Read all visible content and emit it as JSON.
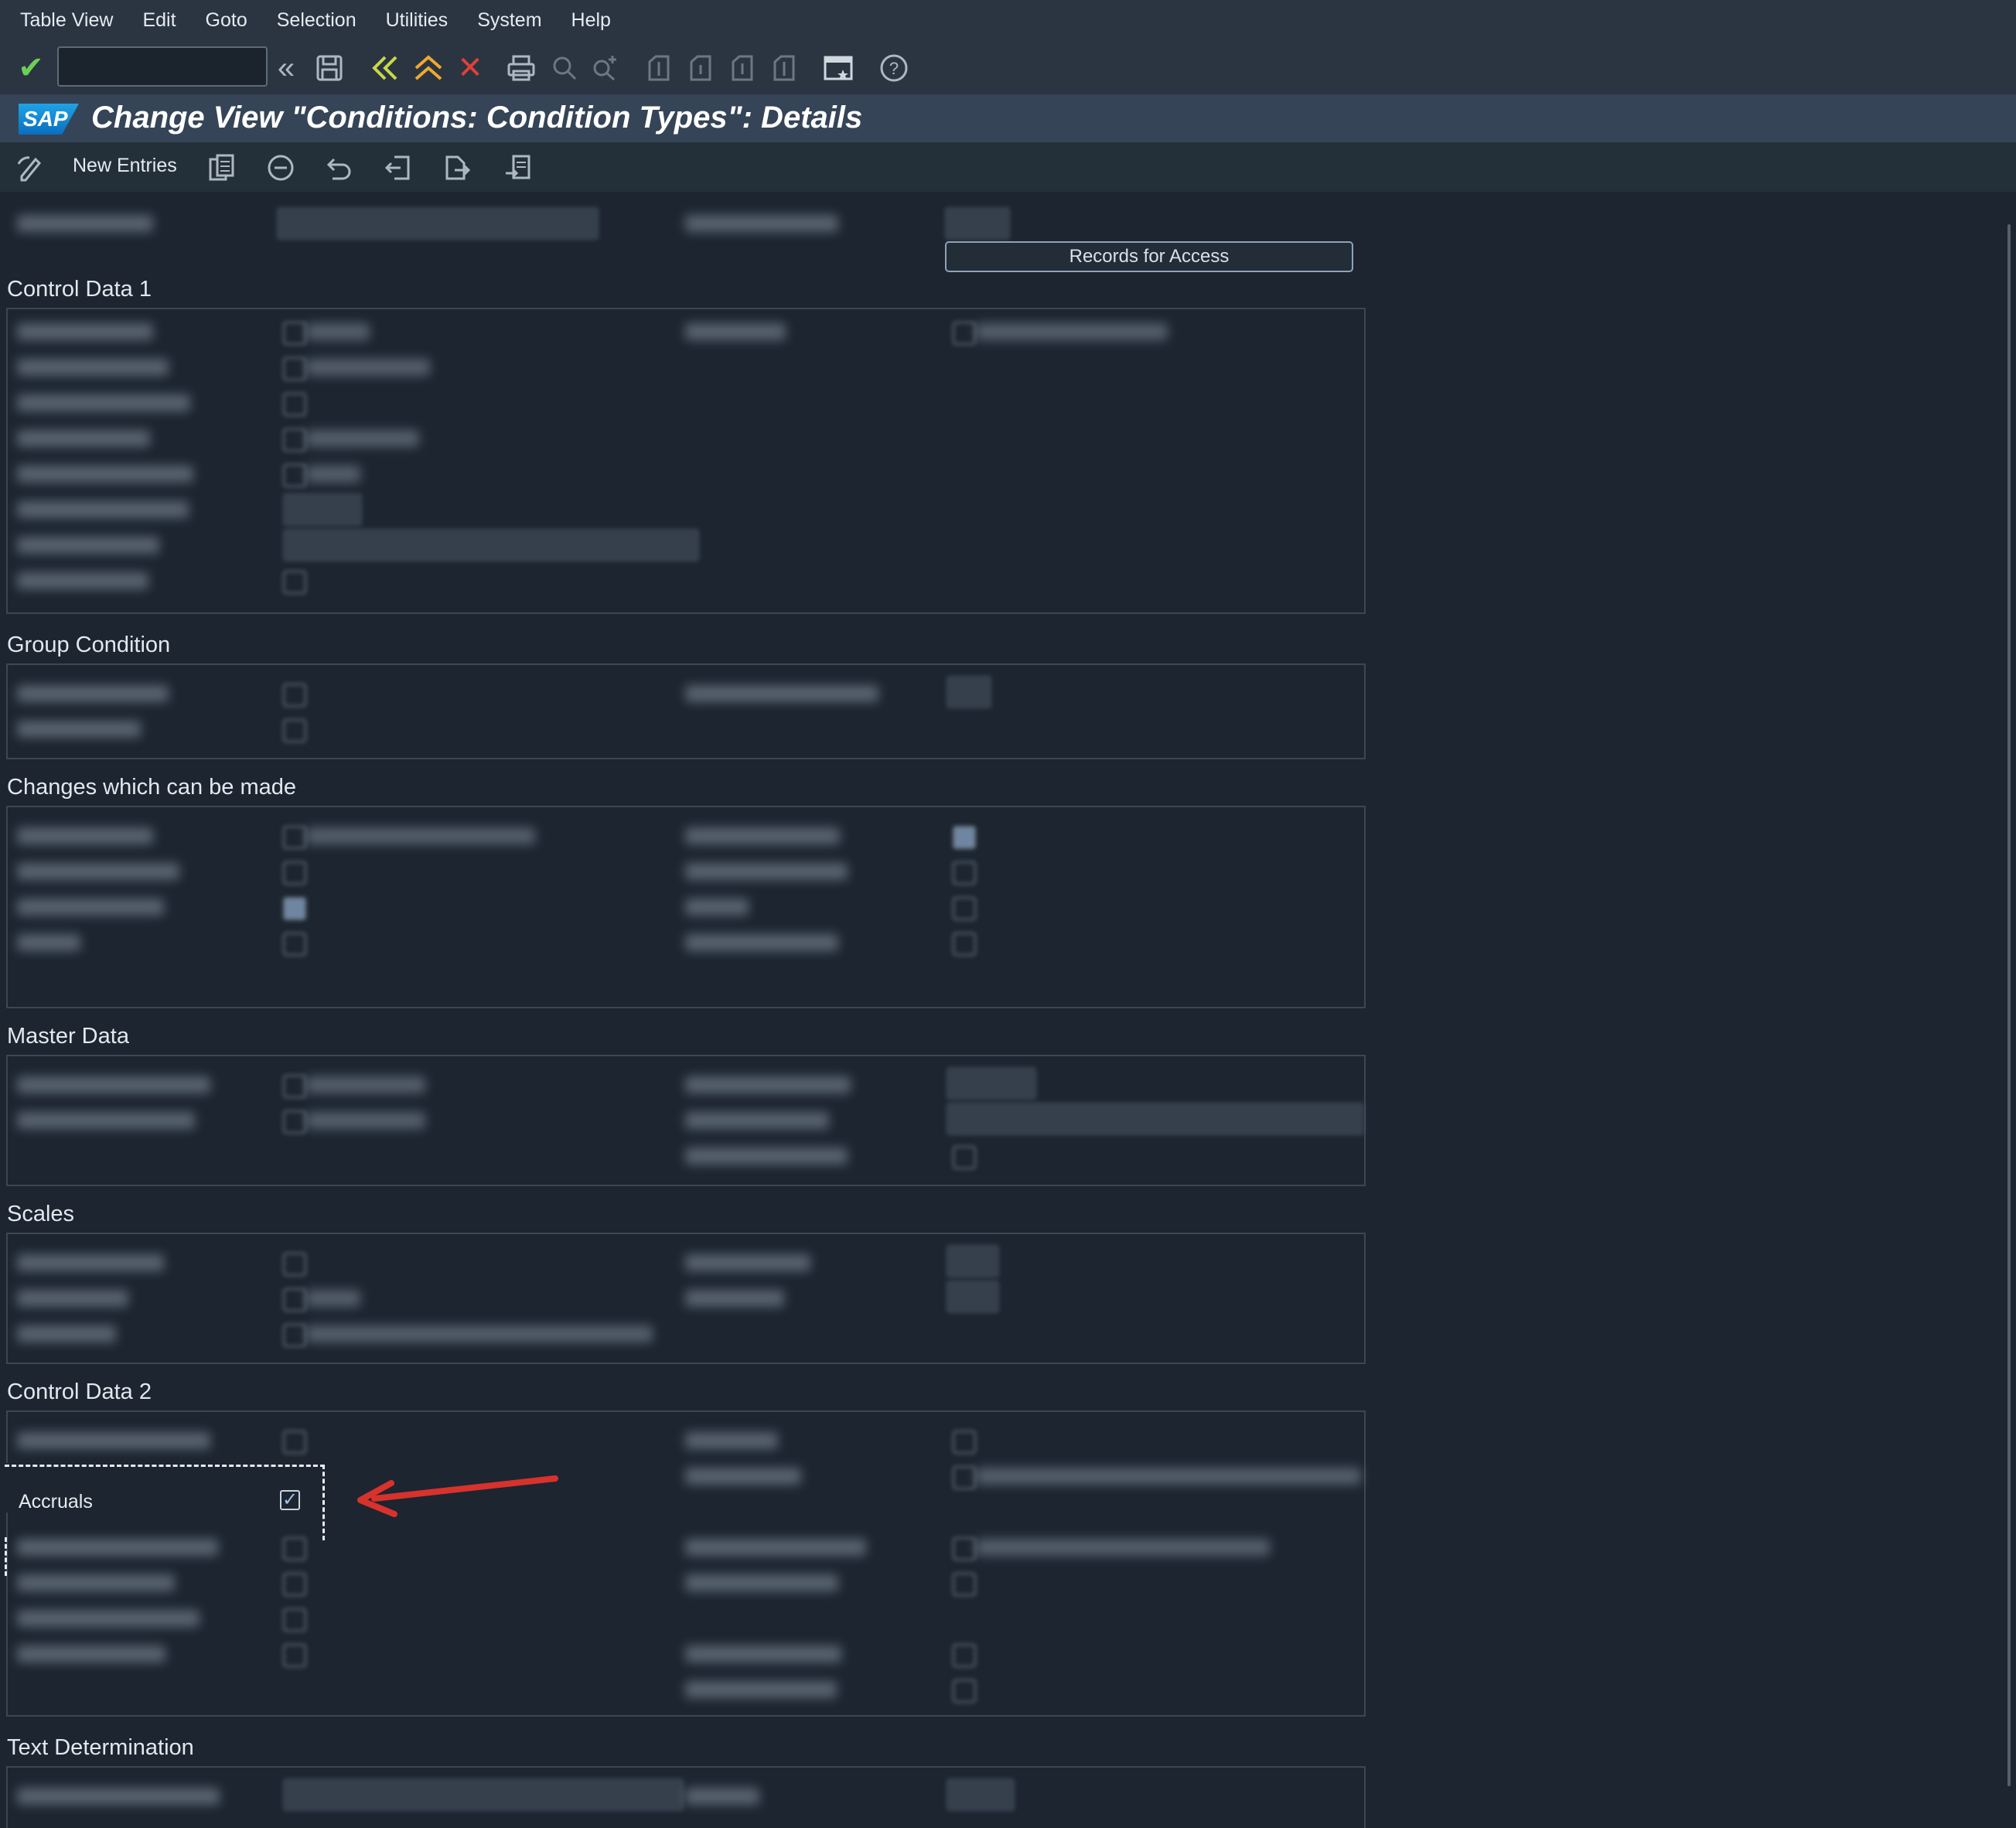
{
  "menu": [
    "Table View",
    "Edit",
    "Goto",
    "Selection",
    "Utilities",
    "System",
    "Help"
  ],
  "window_title": "Change View \"Conditions: Condition Types\": Details",
  "sap_logo_text": "SAP",
  "app_toolbar": {
    "new_entries_label": "New Entries"
  },
  "buttons": {
    "records_for_access": "Records for Access"
  },
  "groups": {
    "control_data_1": "Control Data 1",
    "group_condition": "Group Condition",
    "changes": "Changes which can be made",
    "master_data": "Master Data",
    "scales": "Scales",
    "control_data_2": "Control Data 2",
    "text_determination": "Text Determination"
  },
  "highlight": {
    "label": "Accruals",
    "checked": true
  },
  "colors": {
    "background": "#1c2530",
    "title_bar": "#354456",
    "arrow": "#d8322c"
  }
}
